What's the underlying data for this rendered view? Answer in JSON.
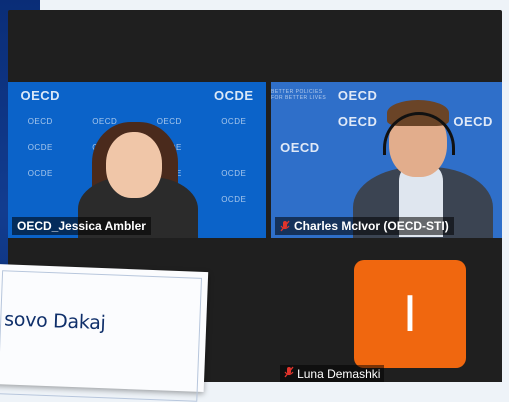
{
  "participants": [
    {
      "id": "jessica",
      "name": "OECD_Jessica Ambler",
      "muted": false
    },
    {
      "id": "charles",
      "name": "Charles McIvor (OECD-STI)",
      "muted": true
    },
    {
      "id": "luna",
      "name": "Luna Demashki",
      "muted": true,
      "avatar_initial": "I"
    }
  ],
  "backdrop": {
    "logo_text_en": "OECD",
    "logo_text_fr": "OCDE",
    "tagline": "BETTER POLICIES FOR BETTER LIVES"
  },
  "name_card": {
    "text": "sovo Dakaj"
  },
  "colors": {
    "backdrop_blue": "#0b63c9",
    "avatar_orange": "#f0670f",
    "mute_red": "#e0342c"
  }
}
